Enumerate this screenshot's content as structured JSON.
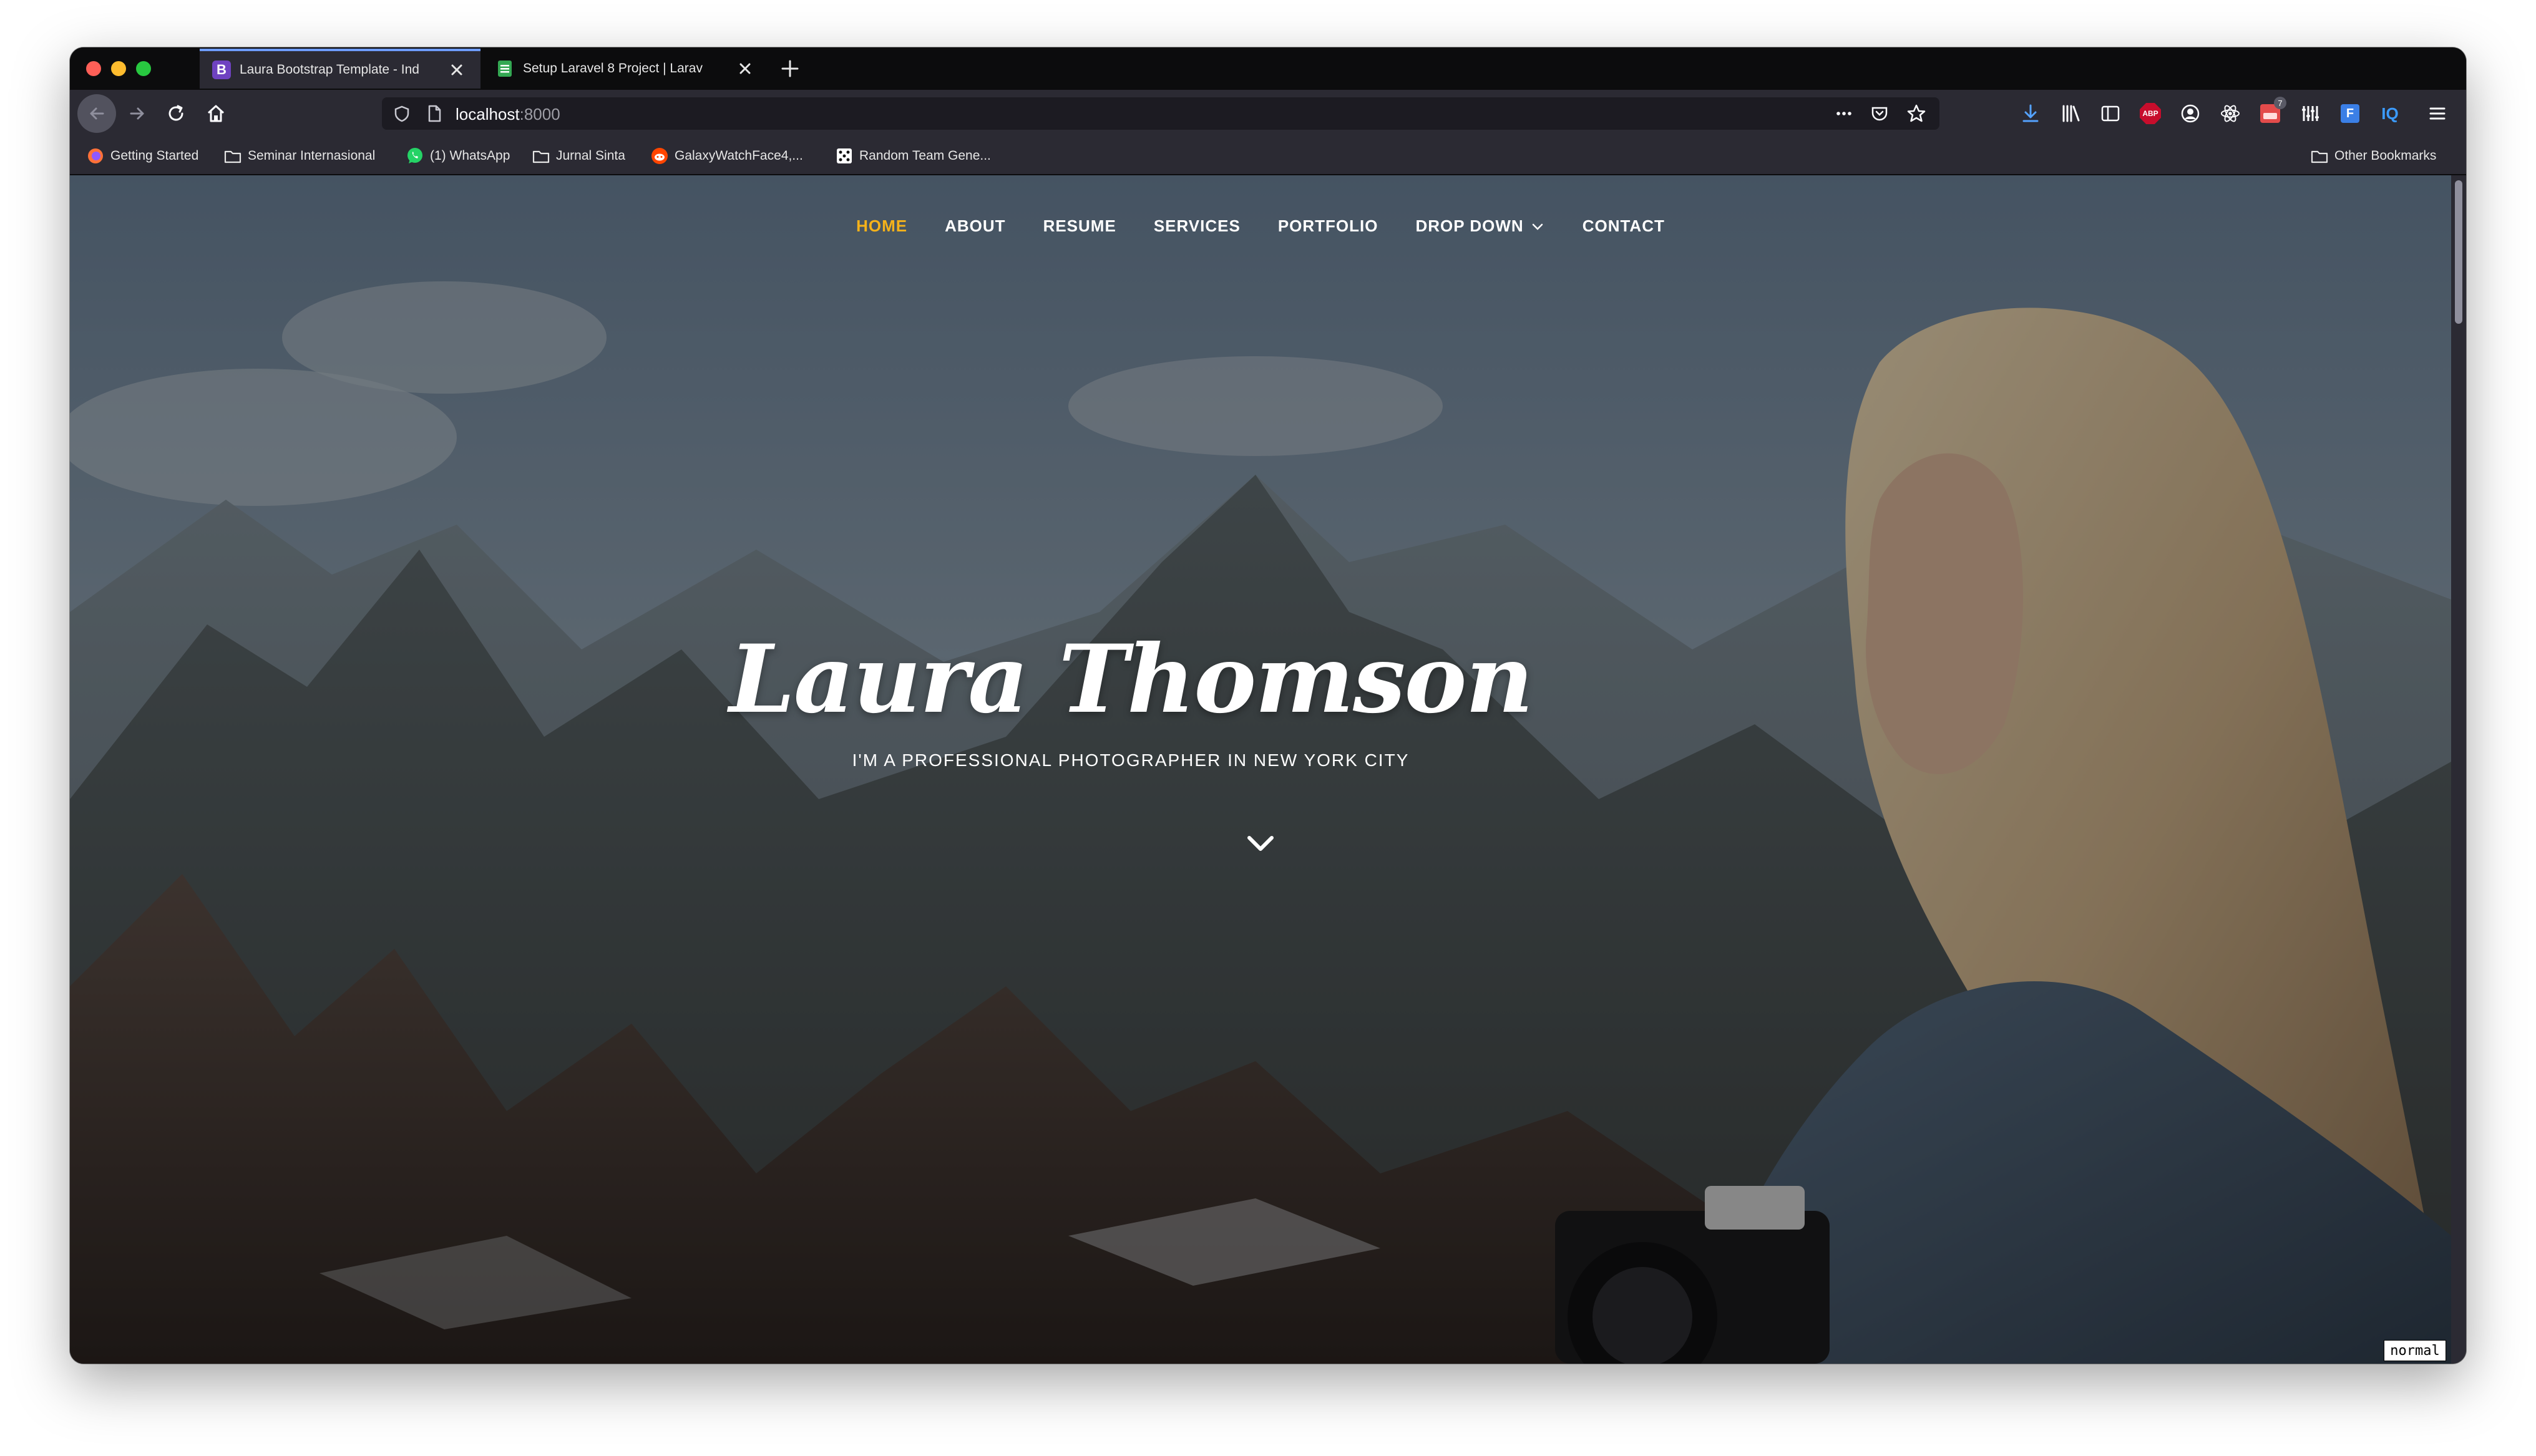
{
  "browser": {
    "tabs": [
      {
        "label": "Laura Bootstrap Template - Ind",
        "favicon": "B"
      },
      {
        "label": "Setup Laravel 8 Project | Larav",
        "favicon": ""
      }
    ],
    "url_host": "localhost",
    "url_port": ":8000"
  },
  "bookmarks": {
    "items": [
      {
        "label": "Getting Started"
      },
      {
        "label": "Seminar Internasional"
      },
      {
        "label": "(1) WhatsApp"
      },
      {
        "label": "Jurnal Sinta"
      },
      {
        "label": "GalaxyWatchFace4,..."
      },
      {
        "label": "Random Team Gene..."
      }
    ],
    "other": "Other Bookmarks"
  },
  "extensions": {
    "abp_label": "ABP",
    "badge_count": "7",
    "iq_label": "IQ"
  },
  "site": {
    "nav": [
      {
        "label": "HOME"
      },
      {
        "label": "ABOUT"
      },
      {
        "label": "RESUME"
      },
      {
        "label": "SERVICES"
      },
      {
        "label": "PORTFOLIO"
      },
      {
        "label": "DROP DOWN"
      },
      {
        "label": "CONTACT"
      }
    ],
    "hero_name": "Laura Thomson",
    "hero_subtitle": "I'M A PROFESSIONAL PHOTOGRAPHER IN NEW YORK CITY"
  },
  "mode_badge": "normal",
  "colors": {
    "nav_active": "#f5b21a",
    "tab_accent": "#6e9cff",
    "toolbar_bg": "#2b2a33"
  }
}
